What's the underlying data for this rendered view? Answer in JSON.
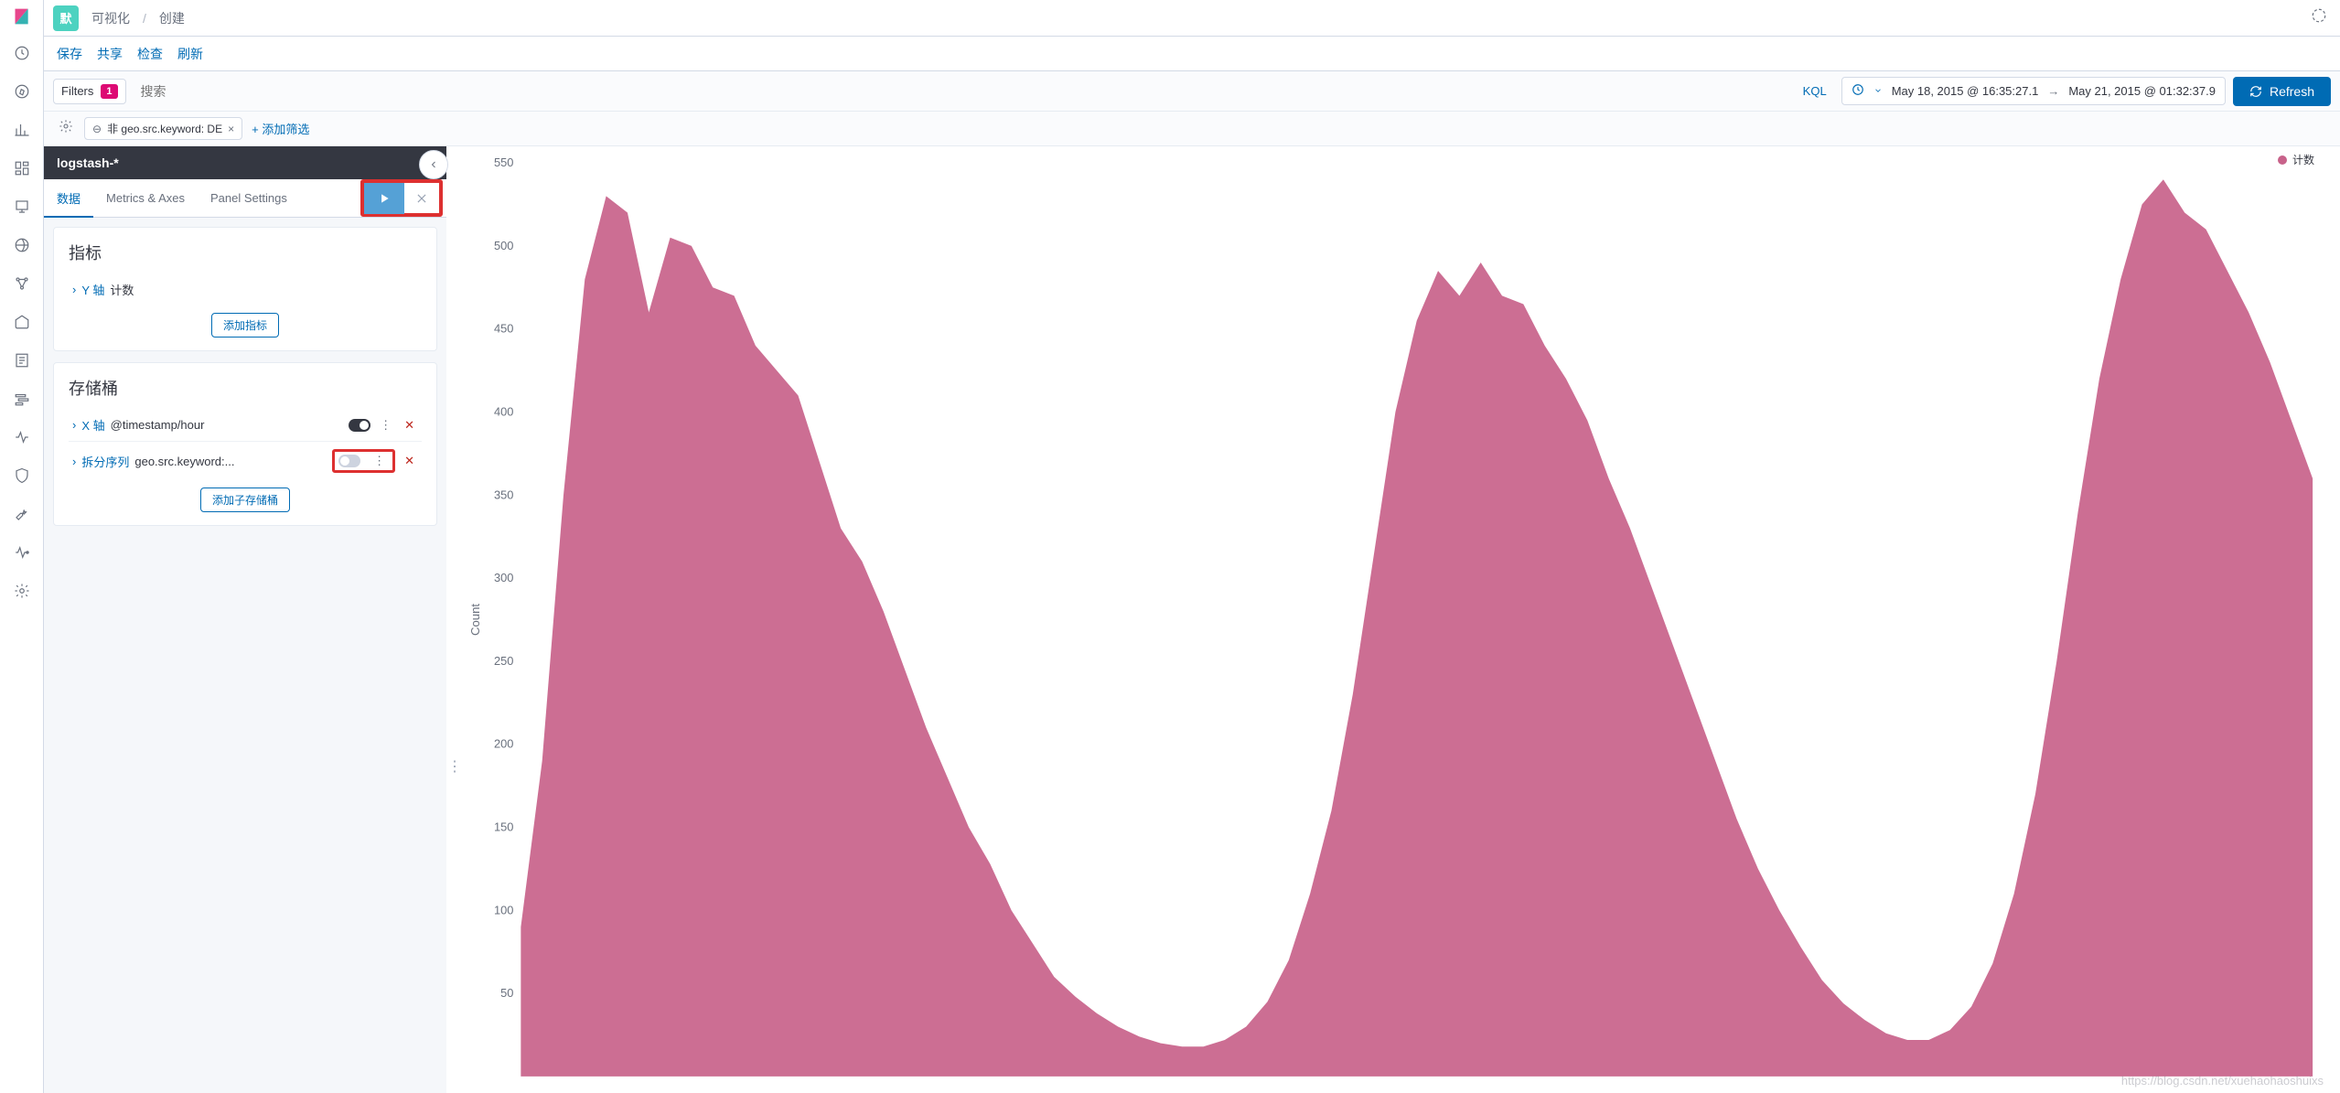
{
  "app_badge": "默",
  "breadcrumb": {
    "item1": "可视化",
    "item2": "创建"
  },
  "actions": {
    "save": "保存",
    "share": "共享",
    "inspect": "检查",
    "refresh_link": "刷新"
  },
  "query": {
    "filters_label": "Filters",
    "filters_count": "1",
    "search_placeholder": "搜索",
    "kql": "KQL",
    "time_from": "May 18, 2015 @ 16:35:27.1",
    "time_to": "May 21, 2015 @ 01:32:37.9",
    "refresh_btn": "Refresh"
  },
  "filter_chip": {
    "text": "非 geo.src.keyword: DE",
    "add": "+ 添加筛选"
  },
  "side": {
    "index_pattern": "logstash-*",
    "tabs": {
      "data": "数据",
      "metrics_axes": "Metrics & Axes",
      "panel_settings": "Panel Settings"
    },
    "metrics": {
      "title": "指标",
      "y_axis": "Y 轴",
      "y_desc": "计数",
      "add_btn": "添加指标"
    },
    "buckets": {
      "title": "存储桶",
      "x_axis": "X 轴",
      "x_desc": "@timestamp/hour",
      "split": "拆分序列",
      "split_desc": "geo.src.keyword:...",
      "add_btn": "添加子存储桶"
    }
  },
  "chart_data": {
    "type": "area",
    "ylabel": "Count",
    "ylim": [
      0,
      550
    ],
    "yticks": [
      50,
      100,
      150,
      200,
      250,
      300,
      350,
      400,
      450,
      500,
      550
    ],
    "legend": "计数",
    "color": "#c8628a",
    "series": [
      {
        "name": "计数",
        "values": [
          90,
          190,
          350,
          480,
          530,
          520,
          460,
          505,
          500,
          475,
          470,
          440,
          425,
          410,
          370,
          330,
          310,
          280,
          245,
          210,
          180,
          150,
          128,
          100,
          80,
          60,
          48,
          38,
          30,
          24,
          20,
          18,
          18,
          22,
          30,
          45,
          70,
          110,
          160,
          230,
          315,
          400,
          455,
          485,
          470,
          490,
          470,
          465,
          440,
          420,
          395,
          360,
          330,
          295,
          260,
          225,
          190,
          155,
          125,
          100,
          78,
          58,
          44,
          34,
          26,
          22,
          22,
          28,
          42,
          68,
          110,
          170,
          250,
          340,
          420,
          480,
          525,
          540,
          520,
          510,
          485,
          460,
          430,
          395,
          360
        ]
      }
    ]
  },
  "watermark": "https://blog.csdn.net/xuehaohaoshuixs"
}
